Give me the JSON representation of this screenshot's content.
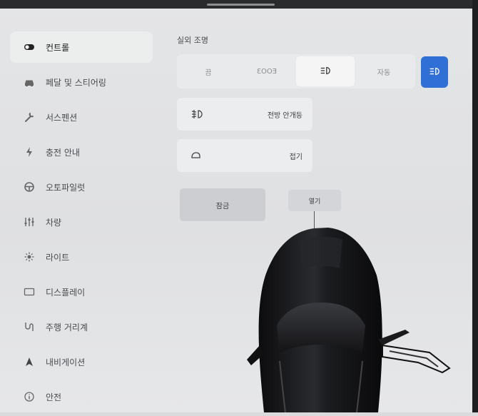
{
  "sidebar": {
    "items": [
      {
        "label": "컨트롤",
        "icon": "toggle-icon",
        "active": true
      },
      {
        "label": "페달 및 스티어링",
        "icon": "car-icon",
        "active": false
      },
      {
        "label": "서스펜션",
        "icon": "wrench-icon",
        "active": false
      },
      {
        "label": "충전 안내",
        "icon": "lightning-icon",
        "active": false
      },
      {
        "label": "오토파일럿",
        "icon": "steering-wheel-icon",
        "active": false
      },
      {
        "label": "차량",
        "icon": "sliders-icon",
        "active": false
      },
      {
        "label": "라이트",
        "icon": "sun-icon",
        "active": false
      },
      {
        "label": "디스플레이",
        "icon": "display-icon",
        "active": false
      },
      {
        "label": "주행 거리계",
        "icon": "trip-icon",
        "active": false
      },
      {
        "label": "내비게이션",
        "icon": "navigation-icon",
        "active": false
      },
      {
        "label": "안전",
        "icon": "info-icon",
        "active": false
      }
    ]
  },
  "lighting": {
    "title": "실외 조명",
    "options": [
      {
        "label": "끔",
        "icon": null,
        "selected": false
      },
      {
        "label": "ƐOOƎ",
        "icon": null,
        "selected": false
      },
      {
        "label": "",
        "icon": "headlight-icon",
        "selected": true
      },
      {
        "label": "자동",
        "icon": null,
        "selected": false
      }
    ],
    "auto_high_beam_icon": "headlight-icon",
    "accent_color": "#2f6fd6"
  },
  "cards": {
    "fog": {
      "label": "전방 안개등",
      "icon": "fog-light-icon"
    },
    "mirror": {
      "label": "접기",
      "icon": "mirror-icon"
    }
  },
  "actions": {
    "lock_label": "잠금",
    "open_label": "열기"
  }
}
